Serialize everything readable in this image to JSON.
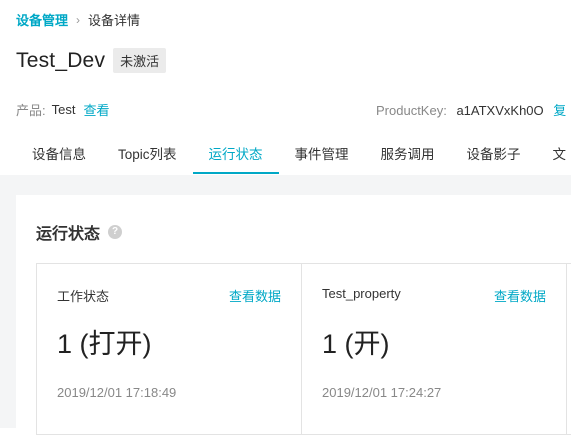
{
  "breadcrumb": {
    "parent": "设备管理",
    "separator": "›",
    "current": "设备详情"
  },
  "device": {
    "name": "Test_Dev",
    "status": "未激活"
  },
  "product": {
    "label": "产品:",
    "value": "Test",
    "view_link": "查看"
  },
  "product_key": {
    "label": "ProductKey:",
    "value": "a1ATXVxKh0O",
    "copy_link": "复"
  },
  "tabs": [
    {
      "label": "设备信息",
      "active": false
    },
    {
      "label": "Topic列表",
      "active": false
    },
    {
      "label": "运行状态",
      "active": true
    },
    {
      "label": "事件管理",
      "active": false
    },
    {
      "label": "服务调用",
      "active": false
    },
    {
      "label": "设备影子",
      "active": false
    },
    {
      "label": "文",
      "active": false
    }
  ],
  "section": {
    "title": "运行状态",
    "help_icon": "question-circle-icon"
  },
  "properties": [
    {
      "name": "工作状态",
      "link": "查看数据",
      "value": "1 (打开)",
      "time": "2019/12/01 17:18:49"
    },
    {
      "name": "Test_property",
      "link": "查看数据",
      "value": "1 (开)",
      "time": "2019/12/01 17:24:27"
    }
  ],
  "colors": {
    "accent": "#00a8c6",
    "page_bg": "#f4f5f6",
    "badge_bg": "#ebebeb"
  }
}
